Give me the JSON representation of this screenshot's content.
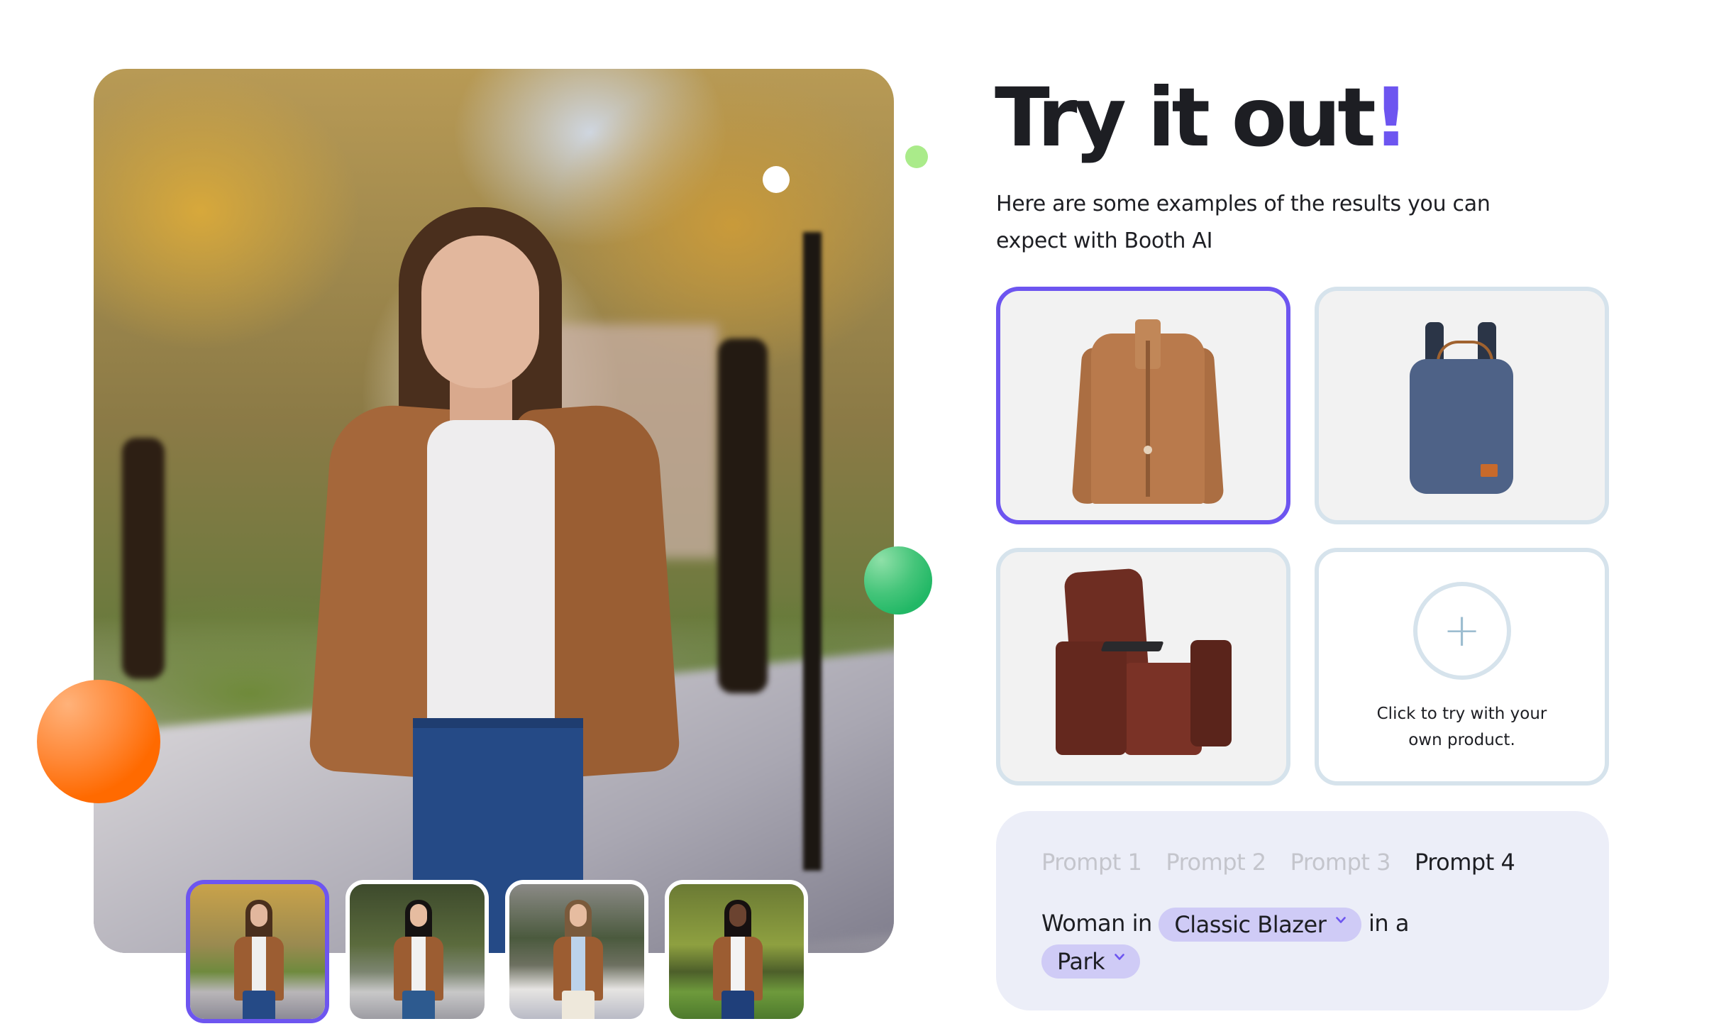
{
  "hero": {
    "main_photo": "woman-in-brown-blazer-park-photo",
    "thumbnails": [
      {
        "label": "woman-park-autumn",
        "selected": true
      },
      {
        "label": "woman-park-green",
        "selected": false
      },
      {
        "label": "woman-street-cream-pants",
        "selected": false
      },
      {
        "label": "woman-park-sunny",
        "selected": false
      }
    ]
  },
  "section": {
    "title": "Try it out",
    "title_accent": "!",
    "subtitle": "Here are some examples of the results you can expect with Booth AI"
  },
  "products": [
    {
      "name": "Classic Blazer",
      "icon": "blazer-image",
      "selected": true
    },
    {
      "name": "Backpack",
      "icon": "backpack-image",
      "selected": false
    },
    {
      "name": "Recliner Chair",
      "icon": "recliner-image",
      "selected": false
    },
    {
      "name": "Upload",
      "icon": "plus-icon",
      "upload_symbol": "+",
      "upload_text": "Click to try with your own product.",
      "selected": false
    }
  ],
  "prompt": {
    "tabs": [
      {
        "label": "Prompt 1",
        "active": false
      },
      {
        "label": "Prompt 2",
        "active": false
      },
      {
        "label": "Prompt 3",
        "active": false
      },
      {
        "label": "Prompt 4",
        "active": true
      }
    ],
    "sentence": {
      "prefix": "Woman in",
      "item_selected": "Classic Blazer",
      "connector": "in a",
      "location_selected": "Park"
    }
  },
  "colors": {
    "accent": "#6d55f0",
    "pill_bg": "#cfcbf6",
    "panel_bg": "#eceef8",
    "card_border": "#d6e3ec",
    "orange_ball": "#ff6a00",
    "green_ball": "#22b866",
    "light_green_dot": "#aaeb8a"
  }
}
